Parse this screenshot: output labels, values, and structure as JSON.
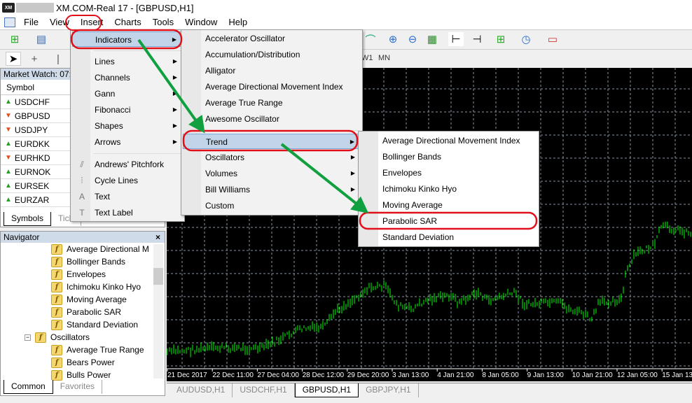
{
  "window": {
    "title": "XM.COM-Real 17 - [GBPUSD,H1]",
    "logo": "XM"
  },
  "menubar": [
    "File",
    "View",
    "Insert",
    "Charts",
    "Tools",
    "Window",
    "Help"
  ],
  "timeframes": [
    "W1",
    "MN"
  ],
  "market_watch": {
    "title": "Market Watch: 07:1",
    "column": "Symbol",
    "rows": [
      {
        "symbol": "USDCHF",
        "dir": "up"
      },
      {
        "symbol": "GBPUSD",
        "dir": "down"
      },
      {
        "symbol": "USDJPY",
        "dir": "down"
      },
      {
        "symbol": "EURDKK",
        "dir": "up"
      },
      {
        "symbol": "EURHKD",
        "dir": "down"
      },
      {
        "symbol": "EURNOK",
        "dir": "up"
      },
      {
        "symbol": "EURSEK",
        "dir": "up"
      },
      {
        "symbol": "EURZAR",
        "dir": "up"
      }
    ],
    "tabs": [
      "Symbols",
      "Tick"
    ]
  },
  "navigator": {
    "title": "Navigator",
    "items": [
      "Average Directional M",
      "Bollinger Bands",
      "Envelopes",
      "Ichimoku Kinko Hyo",
      "Moving Average",
      "Parabolic SAR",
      "Standard Deviation"
    ],
    "group": "Oscillators",
    "group_items": [
      "Average True Range",
      "Bears Power",
      "Bulls Power"
    ],
    "tabs": [
      "Common",
      "Favorites"
    ]
  },
  "insert_menu": {
    "items": [
      "Indicators",
      "Lines",
      "Channels",
      "Gann",
      "Fibonacci",
      "Shapes",
      "Arrows",
      "Andrews' Pitchfork",
      "Cycle Lines",
      "Text",
      "Text Label"
    ]
  },
  "indicators_menu": {
    "items": [
      "Accelerator Oscillator",
      "Accumulation/Distribution",
      "Alligator",
      "Average Directional Movement Index",
      "Average True Range",
      "Awesome Oscillator",
      "Trend",
      "Oscillators",
      "Volumes",
      "Bill Williams",
      "Custom"
    ]
  },
  "trend_menu": {
    "items": [
      "Average Directional Movement Index",
      "Bollinger Bands",
      "Envelopes",
      "Ichimoku Kinko Hyo",
      "Moving Average",
      "Parabolic SAR",
      "Standard Deviation"
    ]
  },
  "chart": {
    "time_labels": [
      "21 Dec 2017",
      "22 Dec 11:00",
      "27 Dec 04:00",
      "28 Dec 12:00",
      "29 Dec 20:00",
      "3 Jan 13:00",
      "4 Jan 21:00",
      "8 Jan 05:00",
      "9 Jan 13:00",
      "10 Jan 21:00",
      "12 Jan 05:00",
      "15 Jan 13:00"
    ],
    "bar_color": "#00ff00",
    "grid_color": "#8a94a0"
  },
  "chart_tabs": [
    "AUDUSD,H1",
    "USDCHF,H1",
    "GBPUSD,H1",
    "GBPJPY,H1"
  ],
  "annotation_colors": {
    "highlight": "#e0101a",
    "arrow": "#10a040"
  }
}
